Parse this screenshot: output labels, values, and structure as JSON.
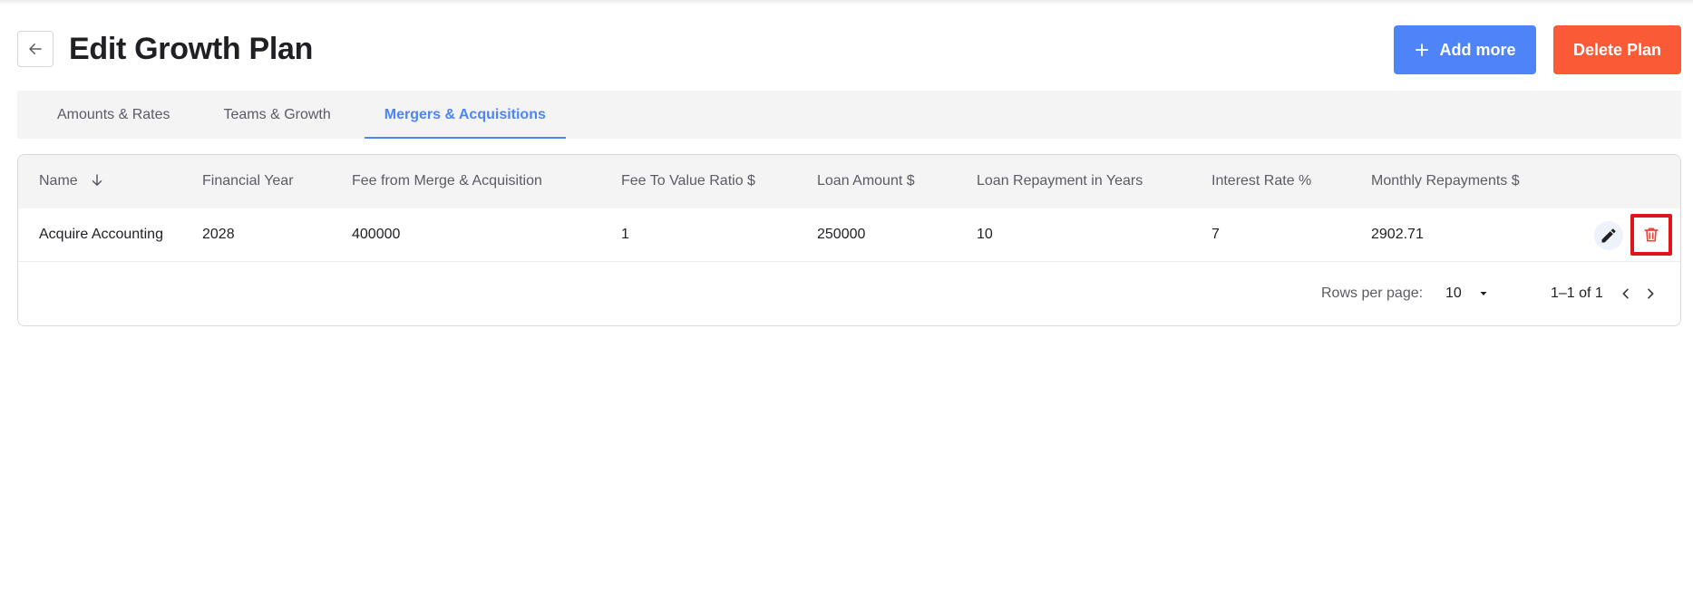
{
  "header": {
    "title": "Edit Growth Plan",
    "add_label": "Add more",
    "delete_label": "Delete Plan"
  },
  "tabs": [
    {
      "label": "Amounts & Rates",
      "active": false
    },
    {
      "label": "Teams & Growth",
      "active": false
    },
    {
      "label": "Mergers & Acquisitions",
      "active": true
    }
  ],
  "table": {
    "columns": [
      "Name",
      "Financial Year",
      "Fee from Merge & Acquisition",
      "Fee To Value Ratio $",
      "Loan Amount $",
      "Loan Repayment in Years",
      "Interest Rate %",
      "Monthly Repayments $"
    ],
    "sort": {
      "column": "Name",
      "direction": "descending"
    },
    "rows": [
      [
        "Acquire Accounting",
        "2028",
        "400000",
        "1",
        "250000",
        "10",
        "7",
        "2902.71"
      ]
    ]
  },
  "pagination": {
    "rows_per_page_label": "Rows per page:",
    "rows_per_page": "10",
    "range": "1–1 of 1"
  },
  "colors": {
    "accent": "#4f84f9",
    "danger": "#fa5a35",
    "highlight": "#e0141c",
    "trash_icon": "#f04438"
  },
  "icons": [
    "arrow-left-icon",
    "plus-icon",
    "arrow-down-icon",
    "pencil-icon",
    "trash-icon",
    "caret-down-icon",
    "chevron-left-icon",
    "chevron-right-icon"
  ]
}
